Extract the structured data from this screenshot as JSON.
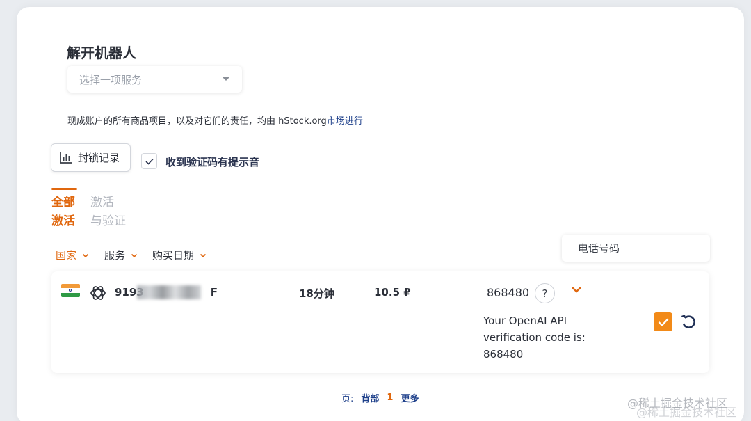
{
  "page": {
    "title": "解开机器人",
    "service_select": {
      "placeholder": "选择一项服务"
    },
    "notice": {
      "text": "现成账户的所有商品项目，以及对它们的责任，均由 hStock.org",
      "link": "市场进行"
    },
    "block_button": {
      "label": "封锁记录",
      "icon": "bar-chart-icon"
    },
    "sound_checkbox": {
      "label": "收到验证码有提示音",
      "checked": true
    },
    "tabs": [
      {
        "line1": "全部",
        "line2": "激活",
        "active": true
      },
      {
        "line1": "激活",
        "line2": "与验证",
        "active": false
      }
    ],
    "filters": {
      "country": "国家",
      "service": "服务",
      "date": "购买日期"
    },
    "phone_search": {
      "placeholder": "电话号码"
    },
    "activation": {
      "flag": "india-flag-icon",
      "service_icon": "openai-icon",
      "phone_prefix": "9193",
      "phone_tail": "F",
      "duration": "18分钟",
      "price": "10.5 ₽",
      "code": "868480",
      "help": "?",
      "message": "Your OpenAI API verification code is: 868480"
    },
    "pagination": {
      "label": "页:",
      "back": "背部",
      "current": "1",
      "more": "更多"
    },
    "watermark": "@稀土掘金技术社区"
  },
  "colors": {
    "accent": "#e0670e",
    "checkbox": "#f28a18",
    "link": "#1d3f8a"
  }
}
